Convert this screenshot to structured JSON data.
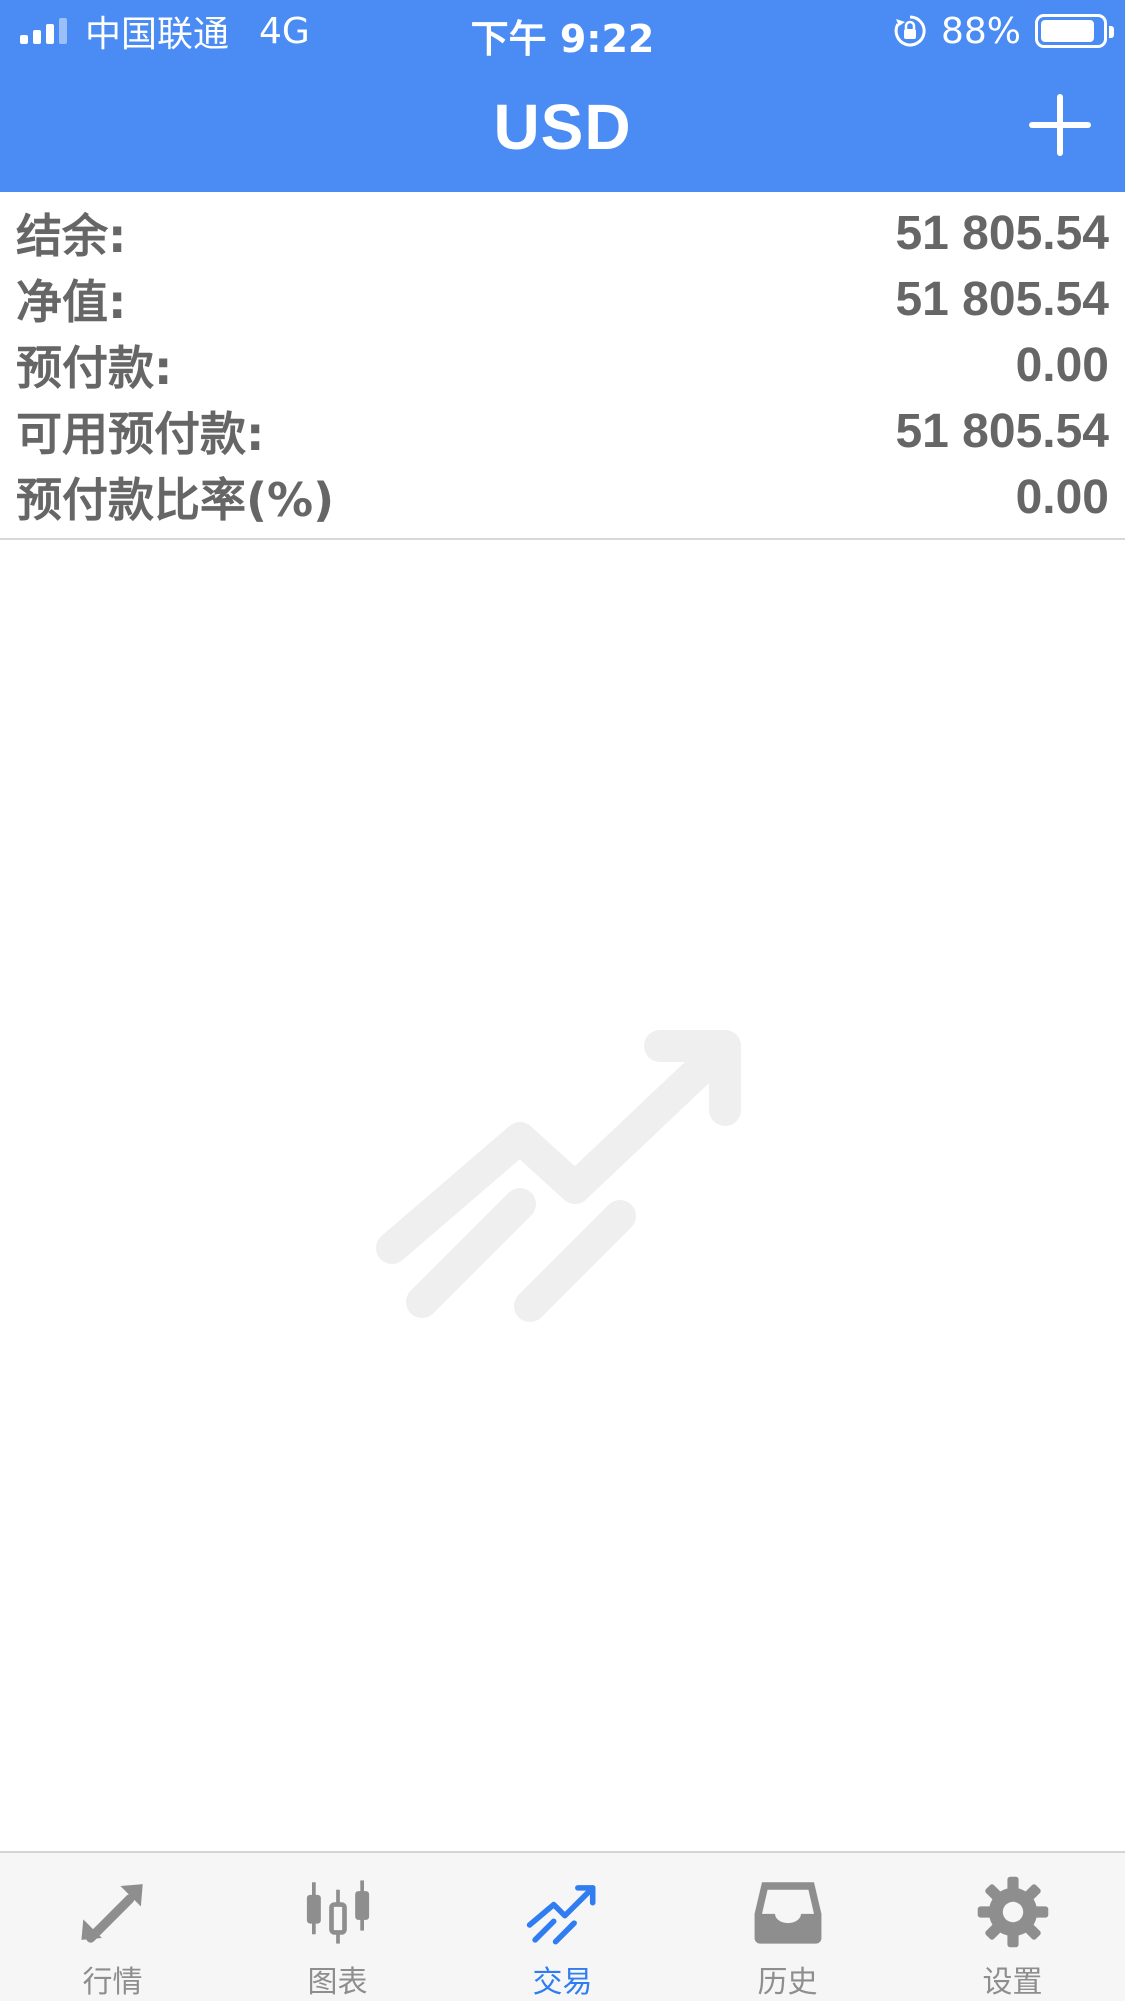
{
  "status_bar": {
    "carrier": "中国联通",
    "network": "4G",
    "time": "下午 9:22",
    "battery_percent": "88%",
    "battery_level": 0.88
  },
  "nav": {
    "title": "USD",
    "add_icon": "plus-icon"
  },
  "account": {
    "rows": [
      {
        "label": "结余:",
        "value": "51 805.54"
      },
      {
        "label": "净值:",
        "value": "51 805.54"
      },
      {
        "label": "预付款:",
        "value": "0.00"
      },
      {
        "label": "可用预付款:",
        "value": "51 805.54"
      },
      {
        "label": "预付款比率(%)",
        "value": "0.00"
      }
    ]
  },
  "empty_state": {
    "icon": "trade-trend-icon"
  },
  "tabbar": {
    "active_color": "#2f7df0",
    "inactive_color": "#8e8e8e",
    "tabs": [
      {
        "label": "行情",
        "icon": "quotes-icon",
        "active": false
      },
      {
        "label": "图表",
        "icon": "chart-icon",
        "active": false
      },
      {
        "label": "交易",
        "icon": "trade-icon",
        "active": true
      },
      {
        "label": "历史",
        "icon": "history-icon",
        "active": false
      },
      {
        "label": "设置",
        "icon": "settings-icon",
        "active": false
      }
    ]
  },
  "colors": {
    "header_bg": "#4a8cf3",
    "text_gray": "#666666"
  }
}
